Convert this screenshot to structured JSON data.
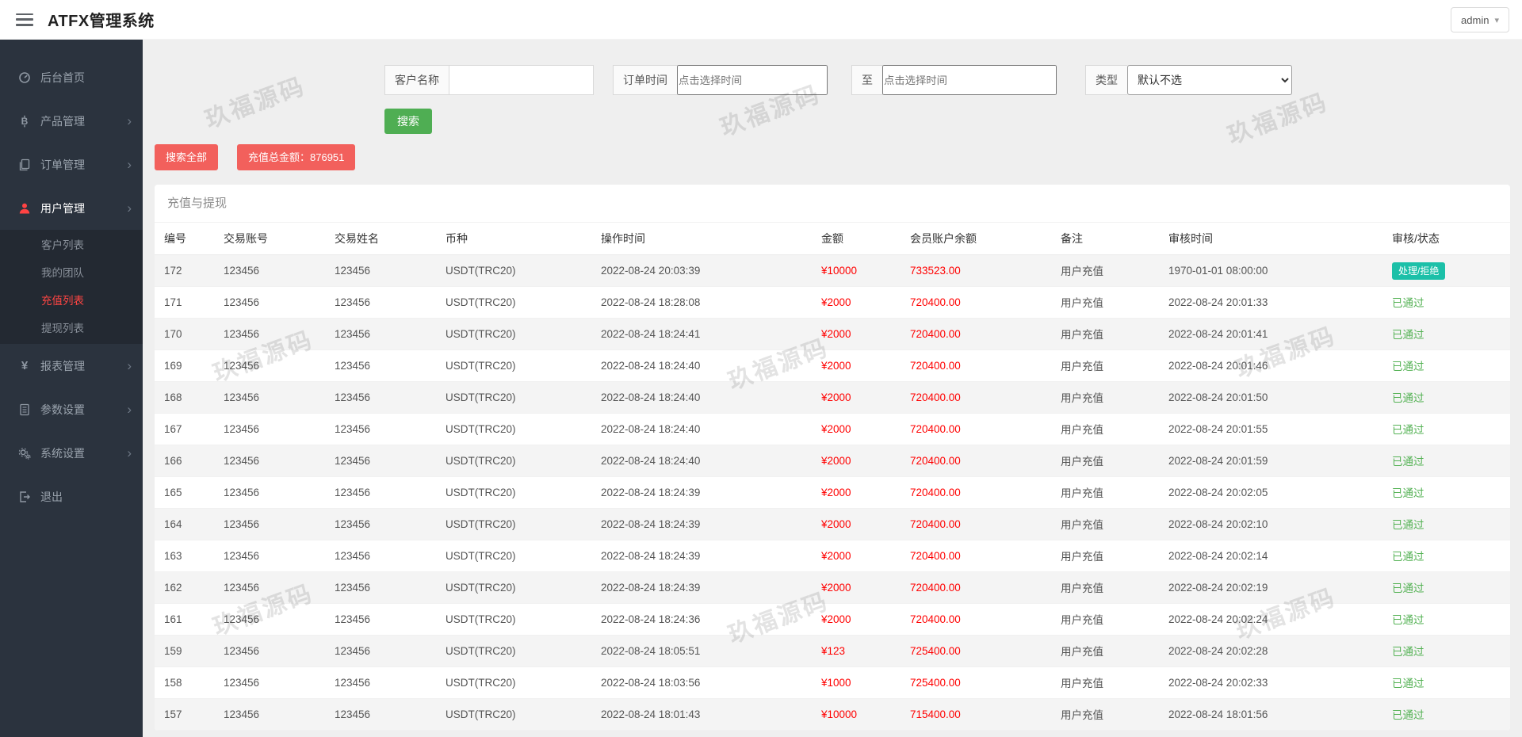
{
  "app": {
    "title": "ATFX管理系统",
    "user": "admin"
  },
  "colors": {
    "sidebar_bg": "#2b333e",
    "active_red": "#ff4343",
    "button_green": "#4fae53",
    "button_danger": "#f2605c",
    "amount_red": "#ff0000",
    "passed_green": "#55b255",
    "pending_teal": "#1cc0a8"
  },
  "sidebar": {
    "items": [
      {
        "label": "后台首页"
      },
      {
        "label": "产品管理"
      },
      {
        "label": "订单管理"
      },
      {
        "label": "用户管理",
        "children": [
          {
            "label": "客户列表"
          },
          {
            "label": "我的团队"
          },
          {
            "label": "充值列表"
          },
          {
            "label": "提现列表"
          }
        ]
      },
      {
        "label": "报表管理"
      },
      {
        "label": "参数设置"
      },
      {
        "label": "系统设置"
      },
      {
        "label": "退出"
      }
    ]
  },
  "filters": {
    "customer_label": "客户名称",
    "order_time_label": "订单时间",
    "time_placeholder": "点击选择时间",
    "to_label": "至",
    "type_label": "类型",
    "type_value": "默认不选",
    "search_button": "搜索"
  },
  "summary": {
    "search_all": "搜索全部",
    "total_amount": "充值总金额：876951"
  },
  "panel": {
    "title": "充值与提现",
    "columns": [
      "编号",
      "交易账号",
      "交易姓名",
      "币种",
      "操作时间",
      "金额",
      "会员账户余额",
      "备注",
      "审核时间",
      "审核/状态"
    ],
    "rows": [
      {
        "id": "172",
        "account": "123456",
        "name": "123456",
        "currency": "USDT(TRC20)",
        "op_time": "2022-08-24 20:03:39",
        "amount": "¥10000",
        "balance": "733523.00",
        "remark": "用户充值",
        "audit_time": "1970-01-01 08:00:00",
        "status": {
          "type": "pending",
          "label": "处理/拒绝"
        }
      },
      {
        "id": "171",
        "account": "123456",
        "name": "123456",
        "currency": "USDT(TRC20)",
        "op_time": "2022-08-24 18:28:08",
        "amount": "¥2000",
        "balance": "720400.00",
        "remark": "用户充值",
        "audit_time": "2022-08-24 20:01:33",
        "status": {
          "type": "passed",
          "label": "已通过"
        }
      },
      {
        "id": "170",
        "account": "123456",
        "name": "123456",
        "currency": "USDT(TRC20)",
        "op_time": "2022-08-24 18:24:41",
        "amount": "¥2000",
        "balance": "720400.00",
        "remark": "用户充值",
        "audit_time": "2022-08-24 20:01:41",
        "status": {
          "type": "passed",
          "label": "已通过"
        }
      },
      {
        "id": "169",
        "account": "123456",
        "name": "123456",
        "currency": "USDT(TRC20)",
        "op_time": "2022-08-24 18:24:40",
        "amount": "¥2000",
        "balance": "720400.00",
        "remark": "用户充值",
        "audit_time": "2022-08-24 20:01:46",
        "status": {
          "type": "passed",
          "label": "已通过"
        }
      },
      {
        "id": "168",
        "account": "123456",
        "name": "123456",
        "currency": "USDT(TRC20)",
        "op_time": "2022-08-24 18:24:40",
        "amount": "¥2000",
        "balance": "720400.00",
        "remark": "用户充值",
        "audit_time": "2022-08-24 20:01:50",
        "status": {
          "type": "passed",
          "label": "已通过"
        }
      },
      {
        "id": "167",
        "account": "123456",
        "name": "123456",
        "currency": "USDT(TRC20)",
        "op_time": "2022-08-24 18:24:40",
        "amount": "¥2000",
        "balance": "720400.00",
        "remark": "用户充值",
        "audit_time": "2022-08-24 20:01:55",
        "status": {
          "type": "passed",
          "label": "已通过"
        }
      },
      {
        "id": "166",
        "account": "123456",
        "name": "123456",
        "currency": "USDT(TRC20)",
        "op_time": "2022-08-24 18:24:40",
        "amount": "¥2000",
        "balance": "720400.00",
        "remark": "用户充值",
        "audit_time": "2022-08-24 20:01:59",
        "status": {
          "type": "passed",
          "label": "已通过"
        }
      },
      {
        "id": "165",
        "account": "123456",
        "name": "123456",
        "currency": "USDT(TRC20)",
        "op_time": "2022-08-24 18:24:39",
        "amount": "¥2000",
        "balance": "720400.00",
        "remark": "用户充值",
        "audit_time": "2022-08-24 20:02:05",
        "status": {
          "type": "passed",
          "label": "已通过"
        }
      },
      {
        "id": "164",
        "account": "123456",
        "name": "123456",
        "currency": "USDT(TRC20)",
        "op_time": "2022-08-24 18:24:39",
        "amount": "¥2000",
        "balance": "720400.00",
        "remark": "用户充值",
        "audit_time": "2022-08-24 20:02:10",
        "status": {
          "type": "passed",
          "label": "已通过"
        }
      },
      {
        "id": "163",
        "account": "123456",
        "name": "123456",
        "currency": "USDT(TRC20)",
        "op_time": "2022-08-24 18:24:39",
        "amount": "¥2000",
        "balance": "720400.00",
        "remark": "用户充值",
        "audit_time": "2022-08-24 20:02:14",
        "status": {
          "type": "passed",
          "label": "已通过"
        }
      },
      {
        "id": "162",
        "account": "123456",
        "name": "123456",
        "currency": "USDT(TRC20)",
        "op_time": "2022-08-24 18:24:39",
        "amount": "¥2000",
        "balance": "720400.00",
        "remark": "用户充值",
        "audit_time": "2022-08-24 20:02:19",
        "status": {
          "type": "passed",
          "label": "已通过"
        }
      },
      {
        "id": "161",
        "account": "123456",
        "name": "123456",
        "currency": "USDT(TRC20)",
        "op_time": "2022-08-24 18:24:36",
        "amount": "¥2000",
        "balance": "720400.00",
        "remark": "用户充值",
        "audit_time": "2022-08-24 20:02:24",
        "status": {
          "type": "passed",
          "label": "已通过"
        }
      },
      {
        "id": "159",
        "account": "123456",
        "name": "123456",
        "currency": "USDT(TRC20)",
        "op_time": "2022-08-24 18:05:51",
        "amount": "¥123",
        "balance": "725400.00",
        "remark": "用户充值",
        "audit_time": "2022-08-24 20:02:28",
        "status": {
          "type": "passed",
          "label": "已通过"
        }
      },
      {
        "id": "158",
        "account": "123456",
        "name": "123456",
        "currency": "USDT(TRC20)",
        "op_time": "2022-08-24 18:03:56",
        "amount": "¥1000",
        "balance": "725400.00",
        "remark": "用户充值",
        "audit_time": "2022-08-24 20:02:33",
        "status": {
          "type": "passed",
          "label": "已通过"
        }
      },
      {
        "id": "157",
        "account": "123456",
        "name": "123456",
        "currency": "USDT(TRC20)",
        "op_time": "2022-08-24 18:01:43",
        "amount": "¥10000",
        "balance": "715400.00",
        "remark": "用户充值",
        "audit_time": "2022-08-24 18:01:56",
        "status": {
          "type": "passed",
          "label": "已通过"
        }
      }
    ]
  },
  "watermark": {
    "text": "玖福源码"
  }
}
